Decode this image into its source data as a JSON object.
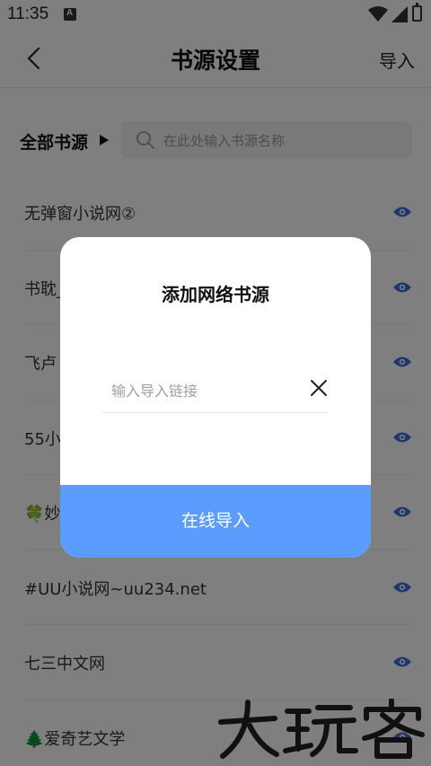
{
  "status_bar": {
    "time": "11:35"
  },
  "header": {
    "title": "书源设置",
    "import_label": "导入"
  },
  "filter": {
    "all_label": "全部书源",
    "search_placeholder": "在此处输入书源名称"
  },
  "sources": [
    {
      "name": "无弹窗小说网②"
    },
    {
      "name": "书耽_"
    },
    {
      "name": "飞卢"
    },
    {
      "name": "55小"
    },
    {
      "name": "🍀妙"
    },
    {
      "name": "#UU小说网~uu234.net"
    },
    {
      "name": "七三中文网"
    },
    {
      "name": "🌲爱奇艺文学"
    }
  ],
  "dialog": {
    "title": "添加网络书源",
    "url_placeholder": "输入导入链接",
    "submit_label": "在线导入"
  },
  "watermark": {
    "text": "大玩客"
  },
  "colors": {
    "accent": "#5b9cff",
    "eye": "#3a6fd8"
  }
}
